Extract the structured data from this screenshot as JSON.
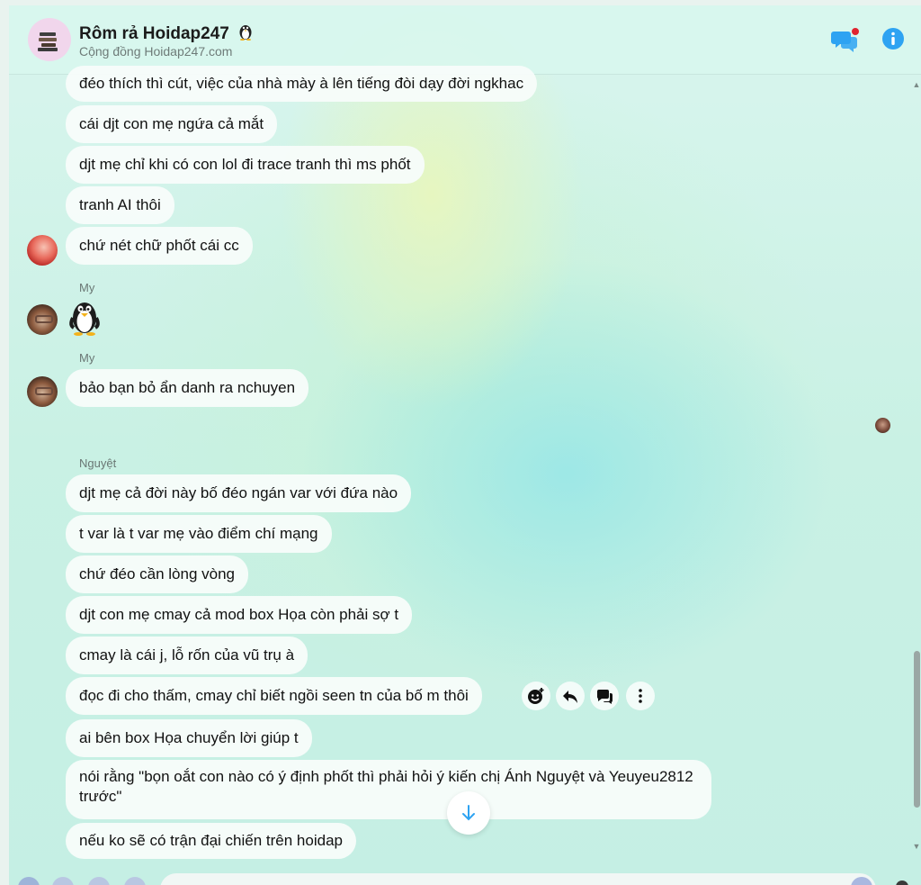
{
  "header": {
    "title": "Rôm rả Hoidap247",
    "subtitle": "Cộng đồng Hoidap247.com",
    "title_emoji": "penguin"
  },
  "colors": {
    "accent": "#2ea3f2",
    "notification_dot": "#e0242f",
    "bubble": "#f7fcfa"
  },
  "messages": {
    "group1": [
      "đéo thích thì cút, việc của nhà mày à lên tiếng đòi dạy đời ngkhac",
      "cái djt con mẹ ngứa cả mắt",
      "djt mẹ chỉ khi có con lol đi trace tranh thì ms phốt",
      "tranh AI thôi",
      "chứ nét chữ phốt cái cc"
    ],
    "my_sender": "My",
    "my_sticker": "penguin",
    "my_sender_2": "My",
    "my_message": "bảo bạn bỏ ẩn danh ra nchuyen",
    "nguyet_sender": "Nguyệt",
    "group2": [
      "djt mẹ cả đời này bố đéo ngán var với đứa nào",
      "t var là t var mẹ vào điểm chí mạng",
      "chứ đéo cần lòng vòng",
      "djt con mẹ cmay cả mod box Họa còn phải sợ t",
      "cmay là cái j, lỗ rốn của vũ trụ à",
      "đọc đi cho thấm, cmay chỉ biết ngồi seen tn của bố m thôi",
      "ai bên box Họa chuyển lời giúp t",
      "nói rằng \"bọn oắt con nào có ý định phốt thì phải hỏi ý kiến chị Ánh Nguyệt và Yeuyeu2812 trước\"",
      "nếu ko sẽ có trận đại chiến trên hoidap"
    ]
  },
  "icons": {
    "header": [
      "group-chat-icon",
      "info-icon"
    ],
    "reactions": [
      "add-reaction-icon",
      "reply-icon",
      "forward-icon",
      "more-icon"
    ],
    "scroll_down": "arrow-down-icon"
  }
}
